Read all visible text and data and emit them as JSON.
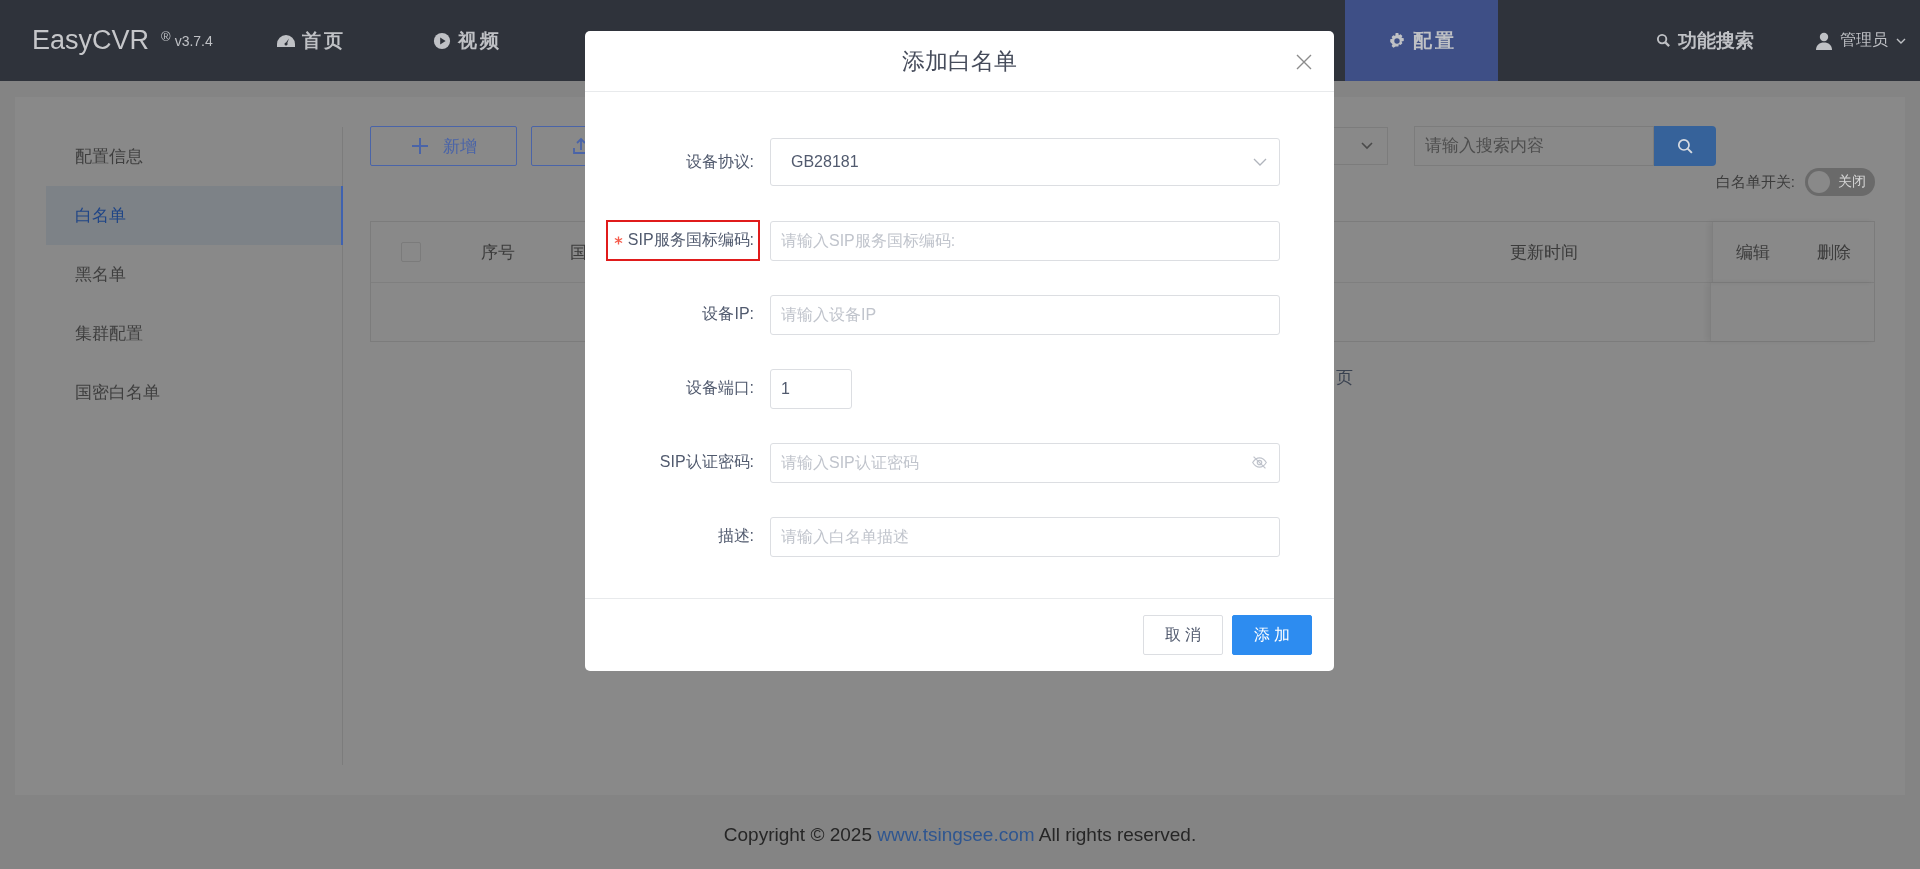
{
  "nav": {
    "logo": "EasyCVR",
    "registered": "®",
    "version": "v3.7.4",
    "items": [
      {
        "label": "首页",
        "selected": false
      },
      {
        "label": "视频",
        "selected": false
      },
      {
        "label": "配置",
        "selected": true
      }
    ],
    "search": "功能搜索",
    "user": "管理员"
  },
  "sidebar": {
    "items": [
      {
        "label": "配置信息",
        "selected": false
      },
      {
        "label": "白名单",
        "selected": true
      },
      {
        "label": "黑名单",
        "selected": false
      },
      {
        "label": "集群配置",
        "selected": false
      },
      {
        "label": "国密白名单",
        "selected": false
      }
    ]
  },
  "toolbar": {
    "add_button": "新增",
    "search_placeholder": "请输入搜索内容",
    "switch": {
      "label": "白名单开关:",
      "on": false,
      "text": "关闭"
    }
  },
  "table": {
    "header_checked": false,
    "columns": [
      "序号",
      "国",
      "更新时间"
    ],
    "fixed_columns": [
      "编辑",
      "删除"
    ]
  },
  "pagination_fragment": "页",
  "dialog": {
    "title": "添加白名单",
    "fields": [
      {
        "label": "设备协议:",
        "kind": "select",
        "value": "GB28181",
        "required": false,
        "highlighted": false
      },
      {
        "label": "SIP服务国标编码:",
        "kind": "text",
        "placeholder": "请输入SIP服务国标编码:",
        "required": true,
        "highlighted": true
      },
      {
        "label": "设备IP:",
        "kind": "text",
        "placeholder": "请输入设备IP",
        "required": false,
        "highlighted": false
      },
      {
        "label": "设备端口:",
        "kind": "number",
        "value": "1",
        "required": false,
        "highlighted": false
      },
      {
        "label": "SIP认证密码:",
        "kind": "password",
        "placeholder": "请输入SIP认证密码",
        "required": false,
        "highlighted": false
      },
      {
        "label": "描述:",
        "kind": "text",
        "placeholder": "请输入白名单描述",
        "required": false,
        "highlighted": false
      }
    ],
    "buttons": [
      {
        "label": "取 消",
        "kind": "default"
      },
      {
        "label": "添 加",
        "kind": "primary"
      }
    ]
  },
  "footer": {
    "before": "Copyright © 2025",
    "link": "www.tsingsee.com",
    "after": "All rights reserved."
  }
}
